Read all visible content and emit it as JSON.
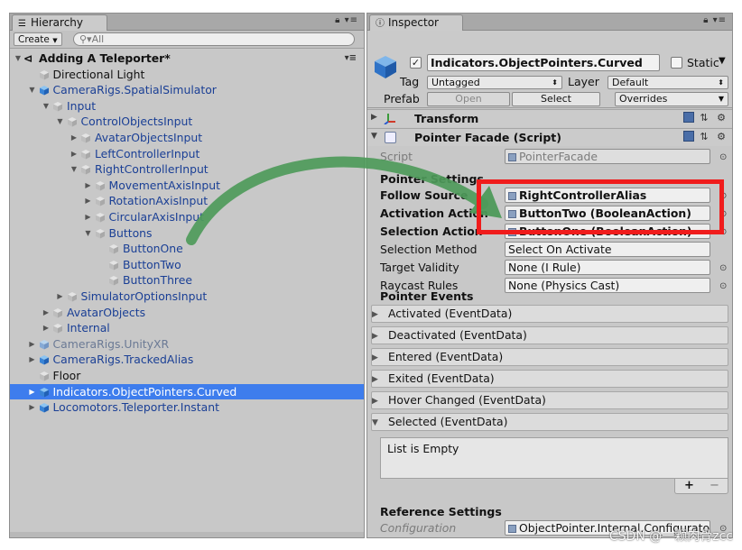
{
  "hierarchy": {
    "tab_label": "Hierarchy",
    "create_label": "Create",
    "search_placeholder": "All",
    "rows": [
      {
        "label": "Adding A Teleporter*",
        "depth": 0,
        "arrow": "▼",
        "icon": "scene",
        "style": "scene"
      },
      {
        "label": "Directional Light",
        "depth": 1,
        "arrow": "",
        "icon": "cube-grey",
        "style": "plain"
      },
      {
        "label": "CameraRigs.SpatialSimulator",
        "depth": 1,
        "arrow": "▼",
        "icon": "cube-blue",
        "style": "prefab"
      },
      {
        "label": "Input",
        "depth": 2,
        "arrow": "▼",
        "icon": "cube-grey",
        "style": "prefab"
      },
      {
        "label": "ControlObjectsInput",
        "depth": 3,
        "arrow": "▼",
        "icon": "cube-grey",
        "style": "prefab"
      },
      {
        "label": "AvatarObjectsInput",
        "depth": 4,
        "arrow": "▶",
        "icon": "cube-grey",
        "style": "prefab"
      },
      {
        "label": "LeftControllerInput",
        "depth": 4,
        "arrow": "▶",
        "icon": "cube-grey",
        "style": "prefab"
      },
      {
        "label": "RightControllerInput",
        "depth": 4,
        "arrow": "▼",
        "icon": "cube-grey",
        "style": "prefab"
      },
      {
        "label": "MovementAxisInput",
        "depth": 5,
        "arrow": "▶",
        "icon": "cube-grey",
        "style": "prefab"
      },
      {
        "label": "RotationAxisInput",
        "depth": 5,
        "arrow": "▶",
        "icon": "cube-grey",
        "style": "prefab"
      },
      {
        "label": "CircularAxisInput",
        "depth": 5,
        "arrow": "▶",
        "icon": "cube-grey",
        "style": "prefab"
      },
      {
        "label": "Buttons",
        "depth": 5,
        "arrow": "▼",
        "icon": "cube-grey",
        "style": "prefab"
      },
      {
        "label": "ButtonOne",
        "depth": 6,
        "arrow": "",
        "icon": "cube-grey",
        "style": "prefab"
      },
      {
        "label": "ButtonTwo",
        "depth": 6,
        "arrow": "",
        "icon": "cube-grey",
        "style": "prefab"
      },
      {
        "label": "ButtonThree",
        "depth": 6,
        "arrow": "",
        "icon": "cube-grey",
        "style": "prefab"
      },
      {
        "label": "SimulatorOptionsInput",
        "depth": 3,
        "arrow": "▶",
        "icon": "cube-grey",
        "style": "prefab"
      },
      {
        "label": "AvatarObjects",
        "depth": 2,
        "arrow": "▶",
        "icon": "cube-grey",
        "style": "prefab"
      },
      {
        "label": "Internal",
        "depth": 2,
        "arrow": "▶",
        "icon": "cube-grey",
        "style": "prefab"
      },
      {
        "label": "CameraRigs.UnityXR",
        "depth": 1,
        "arrow": "▶",
        "icon": "cube-blue-faded",
        "style": "disabled"
      },
      {
        "label": "CameraRigs.TrackedAlias",
        "depth": 1,
        "arrow": "▶",
        "icon": "cube-blue",
        "style": "prefab"
      },
      {
        "label": "Floor",
        "depth": 1,
        "arrow": "",
        "icon": "cube-grey",
        "style": "plain"
      },
      {
        "label": "Indicators.ObjectPointers.Curved",
        "depth": 1,
        "arrow": "▶",
        "icon": "cube-blue",
        "style": "selected"
      },
      {
        "label": "Locomotors.Teleporter.Instant",
        "depth": 1,
        "arrow": "▶",
        "icon": "cube-blue",
        "style": "prefab"
      }
    ]
  },
  "inspector": {
    "tab_label": "Inspector",
    "object_name": "Indicators.ObjectPointers.Curved",
    "static_label": "Static",
    "tag_label": "Tag",
    "tag_value": "Untagged",
    "layer_label": "Layer",
    "layer_value": "Default",
    "prefab_label": "Prefab",
    "prefab_open": "Open",
    "prefab_select": "Select",
    "prefab_overrides": "Overrides",
    "components": {
      "transform": "Transform",
      "pointer_facade": "Pointer Facade (Script)"
    },
    "script_label": "Script",
    "script_value": "PointerFacade",
    "pointer_settings_title": "Pointer Settings",
    "fields": [
      {
        "label": "Follow Source",
        "value": "RightControllerAlias",
        "bold": true
      },
      {
        "label": "Activation Action",
        "value": "ButtonTwo (BooleanAction)",
        "bold": true
      },
      {
        "label": "Selection Action",
        "value": "ButtonOne (BooleanAction)",
        "bold": true
      },
      {
        "label": "Selection Method",
        "value": "Select On Activate",
        "bold": false
      },
      {
        "label": "Target Validity",
        "value": "None (I Rule)",
        "bold": false
      },
      {
        "label": "Raycast Rules",
        "value": "None (Physics Cast)",
        "bold": false
      }
    ],
    "pointer_events_title": "Pointer Events",
    "events": [
      {
        "label": "Activated (EventData)",
        "expanded": false
      },
      {
        "label": "Deactivated (EventData)",
        "expanded": false
      },
      {
        "label": "Entered (EventData)",
        "expanded": false
      },
      {
        "label": "Exited (EventData)",
        "expanded": false
      },
      {
        "label": "Hover Changed (EventData)",
        "expanded": false
      },
      {
        "label": "Selected (EventData)",
        "expanded": true
      }
    ],
    "list_empty": "List is Empty",
    "list_add": "+",
    "list_remove": "−",
    "reference_settings_title": "Reference Settings",
    "configuration_label": "Configuration",
    "configuration_value": "ObjectPointer.Internal.Configurator"
  },
  "watermark": "CSDN @一颗肉骨zcc",
  "colors": {
    "selection": "#3e7ded",
    "highlight_box": "#f01c1c",
    "arrow": "#4e9a5a"
  }
}
